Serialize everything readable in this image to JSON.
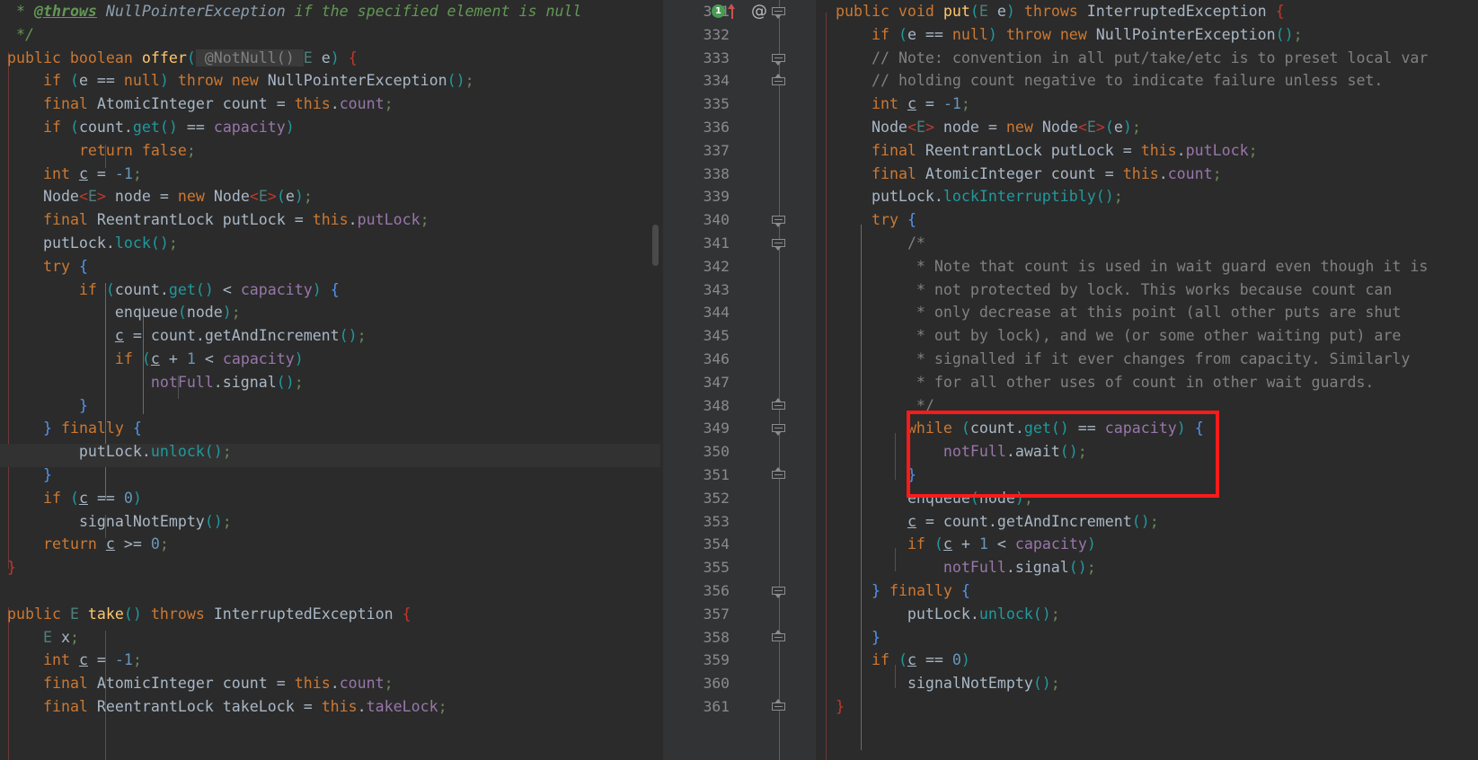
{
  "app": {
    "kind": "code-editor-split-view",
    "theme": "darcula",
    "background": "#2b2b2b",
    "gutter_background": "#313335",
    "caret_line": "#323232",
    "annotation_color": "#fc1b1b"
  },
  "left_pane": {
    "name": "left-editor-pane",
    "caret_line_index": 19,
    "lines": [
      " * @throws NullPointerException if the specified element is null",
      " */",
      "public boolean offer( @NotNull() E e) {",
      "    if (e == null) throw new NullPointerException();",
      "    final AtomicInteger count = this.count;",
      "    if (count.get() == capacity)",
      "        return false;",
      "    int c = -1;",
      "    Node<E> node = new Node<E>(e);",
      "    final ReentrantLock putLock = this.putLock;",
      "    putLock.lock();",
      "    try {",
      "        if (count.get() < capacity) {",
      "            enqueue(node);",
      "            c = count.getAndIncrement();",
      "            if (c + 1 < capacity)",
      "                notFull.signal();",
      "        }",
      "    } finally {",
      "        putLock.unlock();",
      "    }",
      "    if (c == 0)",
      "        signalNotEmpty();",
      "    return c >= 0;",
      "}",
      "",
      "public E take() throws InterruptedException {",
      "    E x;",
      "    int c = -1;",
      "    final AtomicInteger count = this.count;",
      "    final ReentrantLock takeLock = this.takeLock;"
    ]
  },
  "right_pane": {
    "name": "right-editor-pane",
    "first_line_number": 331,
    "last_line_number": 361,
    "line_numbers": [
      331,
      332,
      333,
      334,
      335,
      336,
      337,
      338,
      339,
      340,
      341,
      342,
      343,
      344,
      345,
      346,
      347,
      348,
      349,
      350,
      351,
      352,
      353,
      354,
      355,
      356,
      357,
      358,
      359,
      360,
      361
    ],
    "gutter_icons": {
      "inspection_badge_label": "1",
      "inspection_badge_color": "#499c54",
      "navigate_up_arrow_color": "#c75450",
      "annotation_marker": "@"
    },
    "lines": [
      "public void put(E e) throws InterruptedException {",
      "    if (e == null) throw new NullPointerException();",
      "    // Note: convention in all put/take/etc is to preset local var",
      "    // holding count negative to indicate failure unless set.",
      "    int c = -1;",
      "    Node<E> node = new Node<E>(e);",
      "    final ReentrantLock putLock = this.putLock;",
      "    final AtomicInteger count = this.count;",
      "    putLock.lockInterruptibly();",
      "    try {",
      "        /*",
      "         * Note that count is used in wait guard even though it is",
      "         * not protected by lock. This works because count can",
      "         * only decrease at this point (all other puts are shut",
      "         * out by lock), and we (or some other waiting put) are",
      "         * signalled if it ever changes from capacity. Similarly",
      "         * for all other uses of count in other wait guards.",
      "         */",
      "        while (count.get() == capacity) {",
      "            notFull.await();",
      "        }",
      "        enqueue(node);",
      "        c = count.getAndIncrement();",
      "        if (c + 1 < capacity)",
      "            notFull.signal();",
      "    } finally {",
      "        putLock.unlock();",
      "    }",
      "    if (c == 0)",
      "        signalNotEmpty();",
      "}"
    ],
    "annotation": {
      "name": "highlight-box-while-loop",
      "label": "red rectangle highlighting the while(count.get() == capacity) block",
      "covered_line_numbers": [
        349,
        350,
        351
      ],
      "covered_code": [
        "while (count.get() == capacity) {",
        "    notFull.await();",
        "}"
      ]
    }
  }
}
